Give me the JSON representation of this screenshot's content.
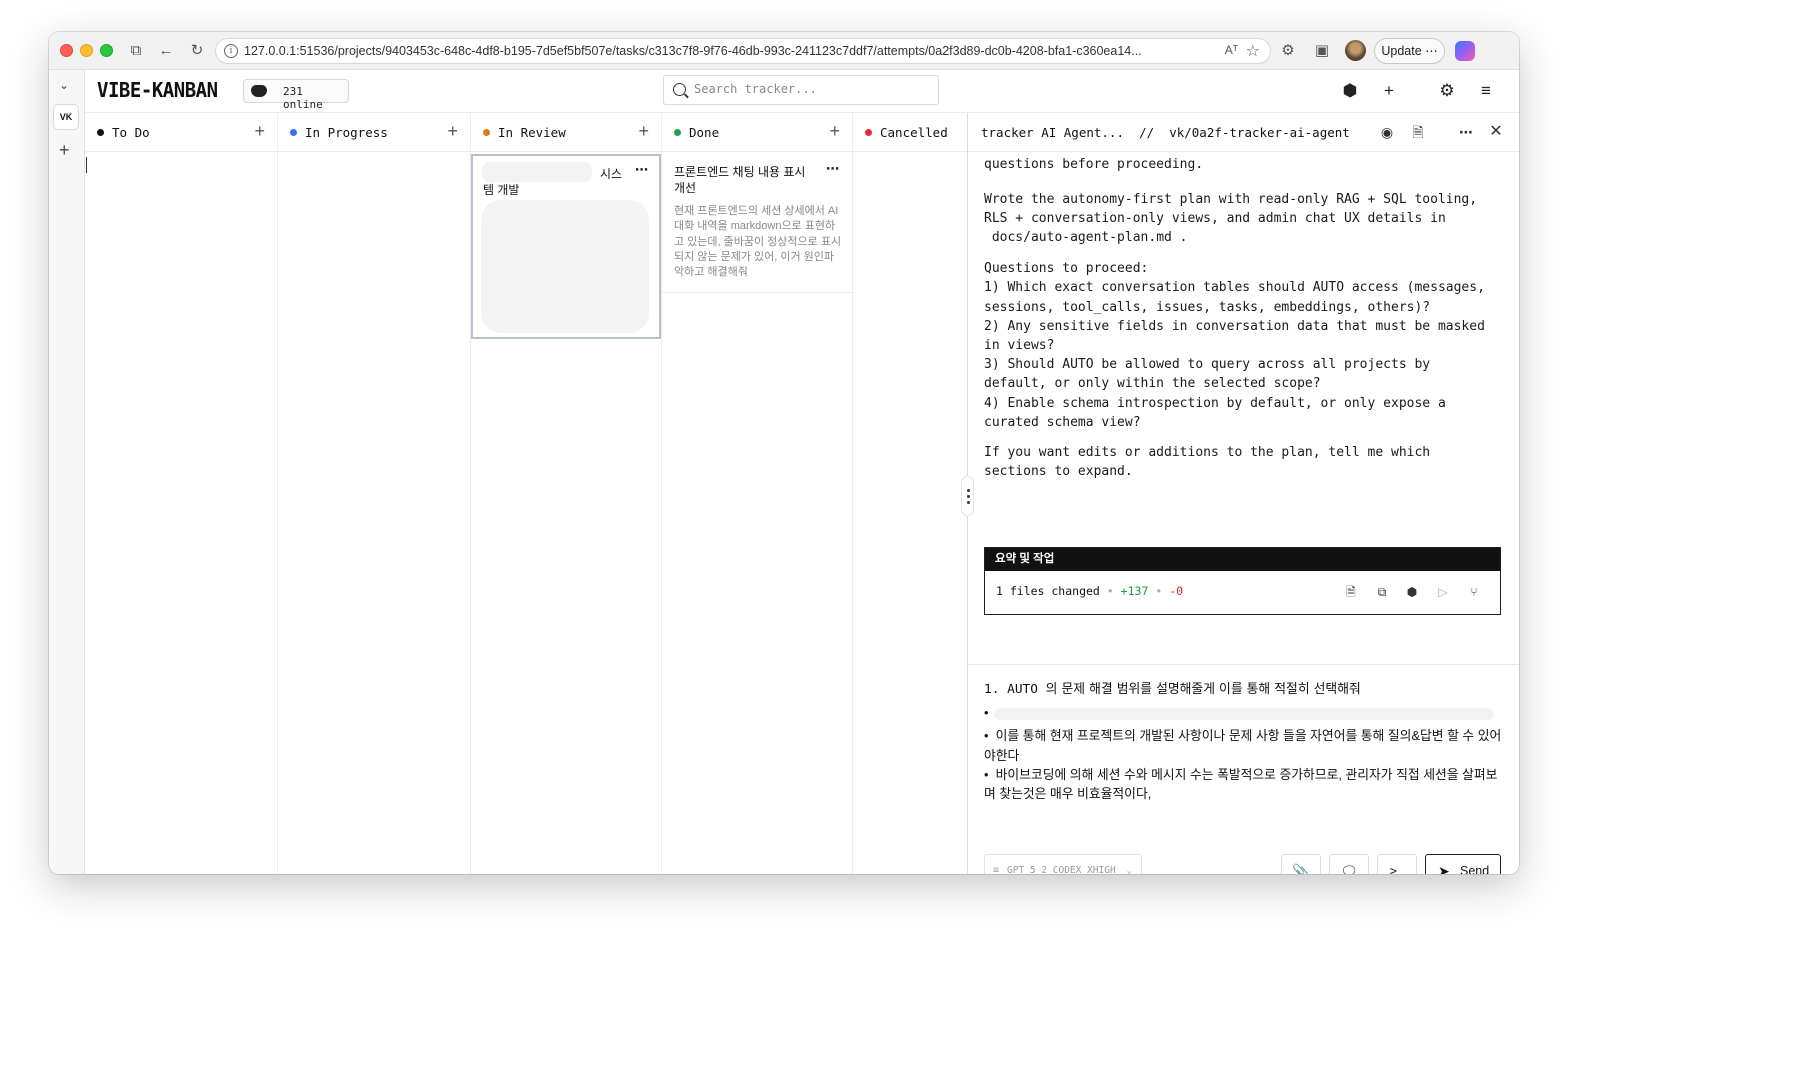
{
  "browser": {
    "url": "127.0.0.1:51536/projects/9403453c-648c-4df8-b195-7d5ef5bf507e/tasks/c313c7f8-9f76-46db-993c-241123c7ddf7/attempts/0a2f3d89-dc0b-4208-bfa1-c360ea14...",
    "reader_label": "Aᵀ",
    "update_label": "Update ⋯"
  },
  "rail": {
    "workspace_badge": "VK"
  },
  "header": {
    "logo": "VIBE-KANBAN",
    "online_count": "231 online",
    "search_placeholder": "Search tracker..."
  },
  "columns": [
    {
      "title": "To Do",
      "color": "#111111"
    },
    {
      "title": "In Progress",
      "color": "#3b6cf6"
    },
    {
      "title": "In Review",
      "color": "#e07a10"
    },
    {
      "title": "Done",
      "color": "#22a04b"
    },
    {
      "title": "Cancelled",
      "color": "#e5283a"
    }
  ],
  "cards": {
    "review_card": {
      "title_part1": "시스",
      "title_part2": "템 개발"
    },
    "done_card": {
      "title": "프론트엔드 채팅 내용 표시 개선",
      "description": "현재 프론트엔드의 세션 상세에서 AI 대화 내역을 markdown으로 표현하고 있는데, 줄바꿈이 정상적으로 표시되지 않는 문제가 있어, 이거 원인파악하고 해결해줘"
    }
  },
  "panel": {
    "title": "tracker AI Agent...",
    "separator": "//",
    "branch": "vk/0a2f-tracker-ai-agent",
    "messages": {
      "cut_line": "questions before proceeding.",
      "para1_a": "Wrote the autonomy-first plan with read-only RAG + SQL tooling,",
      "para1_b": "RLS + conversation-only views, and admin chat UX details in",
      "para1_code": "docs/auto-agent-plan.md",
      "para1_end": ".",
      "q_header": "Questions to proceed:",
      "q1a": "1) Which exact conversation tables should AUTO access (messages,",
      "q1b": "sessions, tool_calls, issues, tasks, embeddings, others)?",
      "q2a": "2) Any sensitive fields in conversation data that must be masked",
      "q2b": "in views?",
      "q3a": "3) Should AUTO be allowed to query across all projects by",
      "q3b": "default, or only within the selected scope?",
      "q4a": "4) Enable schema introspection by default, or only expose a",
      "q4b": "curated schema view?",
      "closing_a": "If you want edits or additions to the plan, tell me which",
      "closing_b": "sections to expand."
    },
    "summary": {
      "title": "요약 및 작업",
      "files_changed": "1 files changed",
      "dot": "•",
      "additions": "+137",
      "deletions": "-0"
    },
    "composer": {
      "line1_prefix": "1. AUTO",
      "line1_rest": "의 문제 해결 범위를 설명해줄게 이를 통해 적절히 선택해줘",
      "bullet": "•",
      "bullet2": "이를 통해 현재 프로젝트의 개발된 사항이나 문제 사항 들을 자연어를 통해 질의&답변 할 수 있어야한다",
      "bullet3": "바이브코딩에 의해 세션 수와 메시지 수는 폭발적으로 증가하므로, 관리자가 직접 세션을 살펴보며 찾는것은 매우 비효율적이다,"
    },
    "model": "GPT_5_2_CODEX_XHIGH",
    "send_label": "Send"
  }
}
